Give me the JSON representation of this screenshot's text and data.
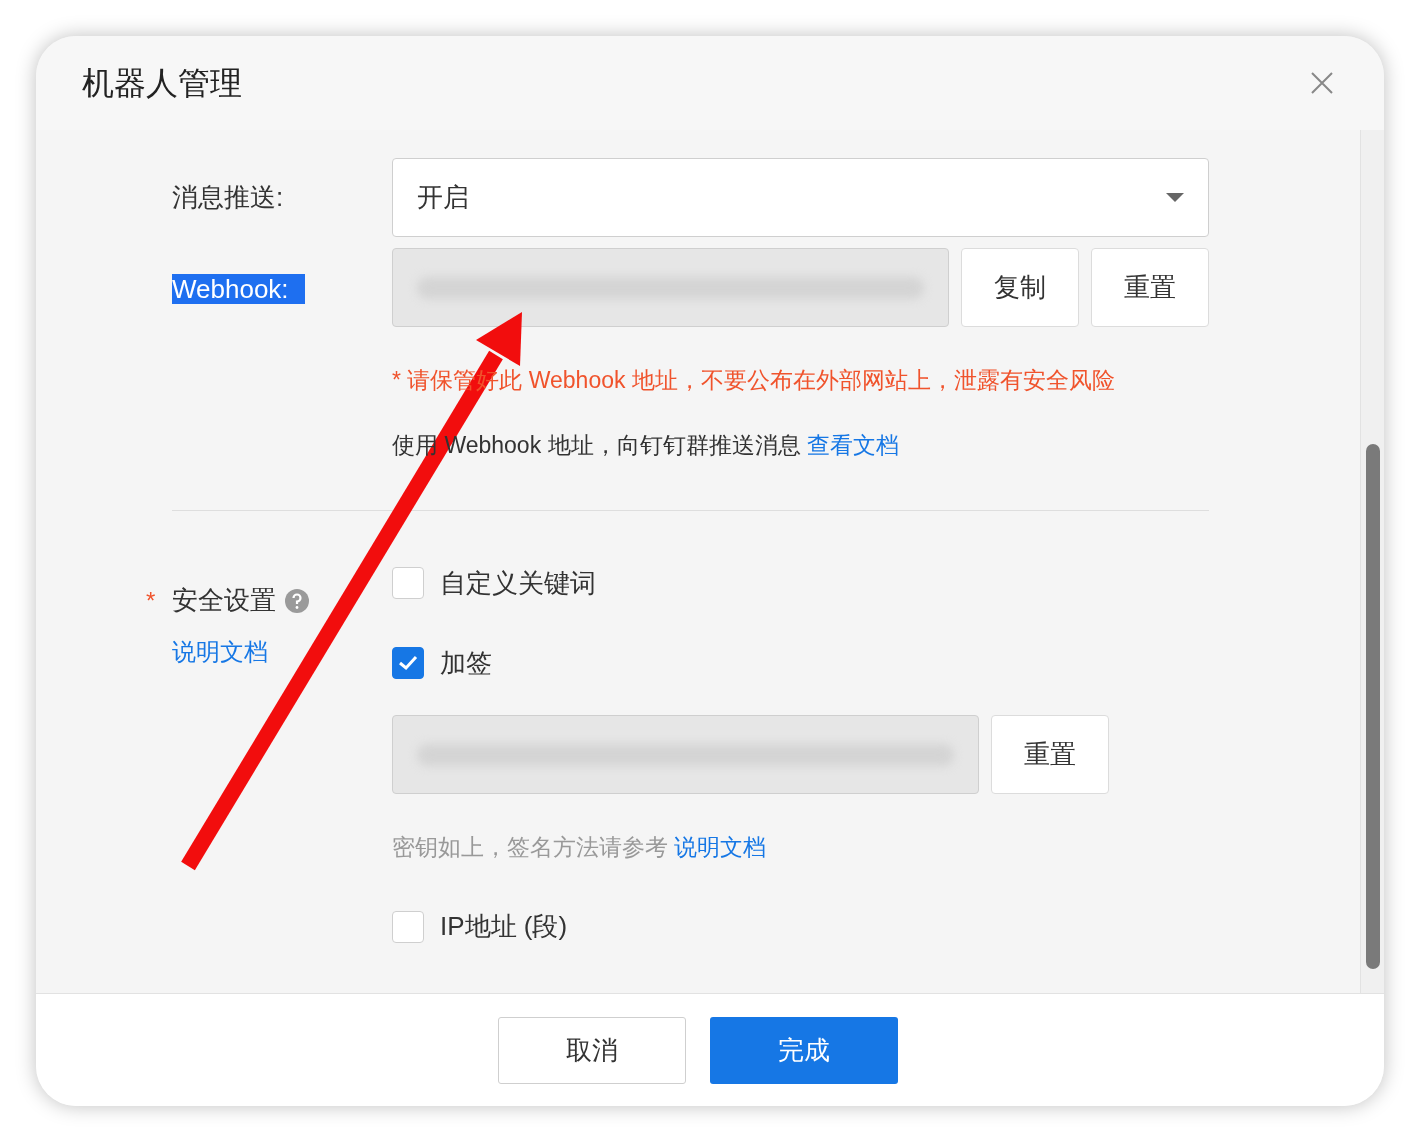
{
  "dialog": {
    "title": "机器人管理"
  },
  "push": {
    "label": "消息推送:",
    "value": "开启"
  },
  "webhook": {
    "label": "Webhook:",
    "label_highlighted": true,
    "buttons": [
      "复制",
      "重置"
    ]
  },
  "warning": "* 请保管好此 Webhook 地址，不要公布在外部网站上，泄露有安全风险",
  "usage": {
    "text": "使用 Webhook 地址，向钉钉群推送消息",
    "link": "查看文档"
  },
  "security": {
    "required_mark": "*",
    "label": "安全设置",
    "doc_link": "说明文档",
    "options": [
      {
        "label": "自定义关键词",
        "checked": false
      },
      {
        "label": "加签",
        "checked": true
      },
      {
        "label": "IP地址 (段)",
        "checked": false
      }
    ],
    "secret": {
      "button": "重置",
      "hint": "密钥如上，签名方法请参考",
      "link": "说明文档"
    }
  },
  "footer": {
    "buttons": [
      {
        "label": "取消",
        "kind": "secondary"
      },
      {
        "label": "完成",
        "kind": "primary"
      }
    ]
  }
}
